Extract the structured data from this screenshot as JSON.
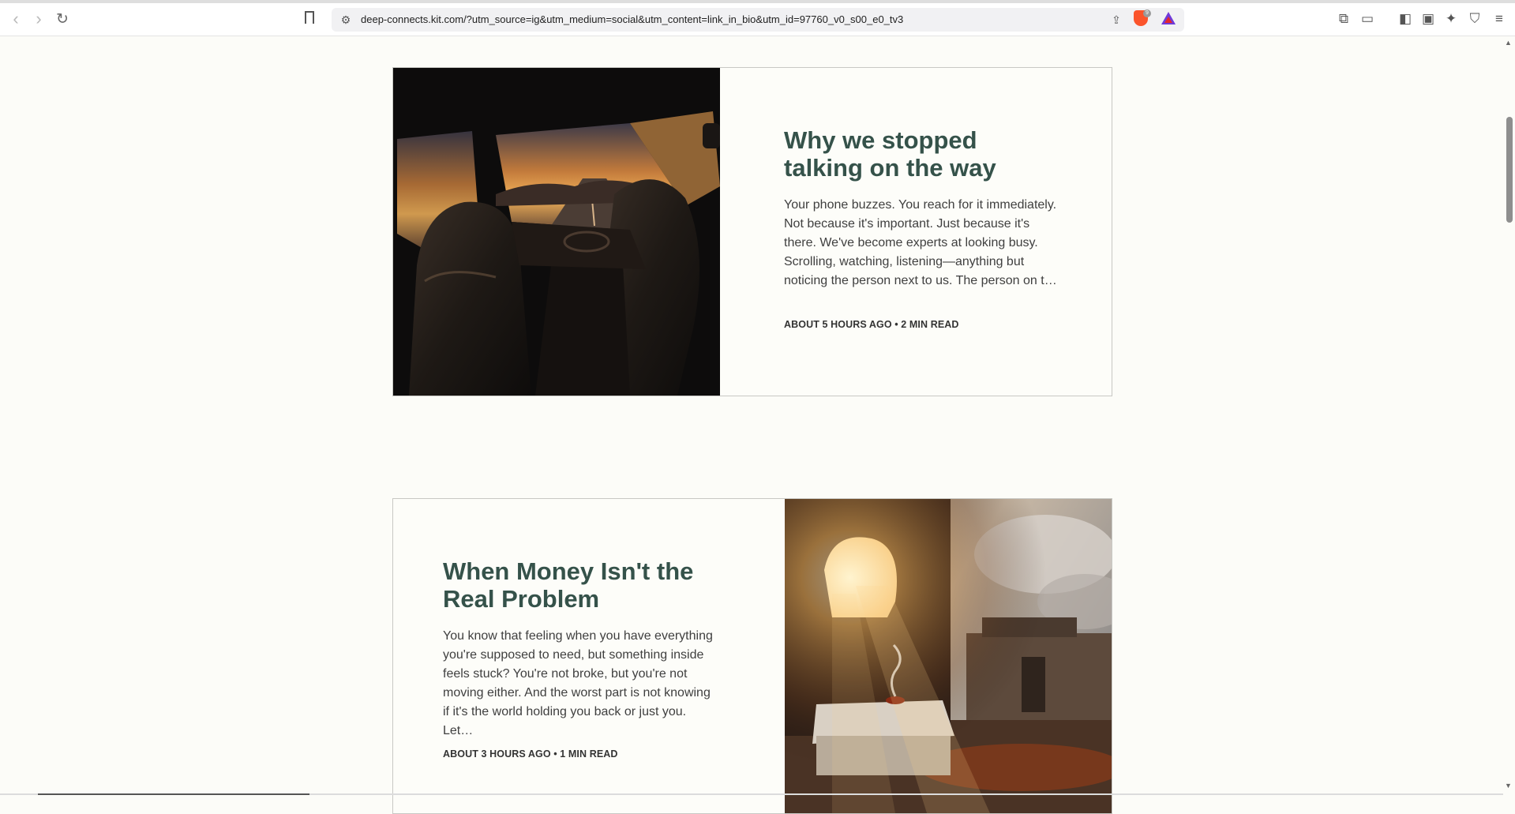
{
  "browser": {
    "url": "deep-connects.kit.com/?utm_source=ig&utm_medium=social&utm_content=link_in_bio&utm_id=97760_v0_s00_e0_tv3",
    "shield_count": "9",
    "icons": {
      "back": "chevron-left-icon",
      "forward": "chevron-right-icon",
      "reload": "reload-icon",
      "bookmark": "bookmark-icon",
      "site_info": "site-settings-icon",
      "share": "share-icon",
      "brave_shield": "brave-shield-icon",
      "rewards": "brave-rewards-icon",
      "extensions": "puzzle-icon",
      "tab_search": "tab-search-icon",
      "sidebar": "sidebar-icon",
      "wallet": "wallet-icon",
      "leo": "sparkle-icon",
      "vpn": "vpn-shield-icon",
      "menu": "hamburger-menu-icon"
    }
  },
  "posts": [
    {
      "title": "Why we stopped talking on the way",
      "excerpt": "Your phone buzzes. You reach for it immediately. Not because it's important. Just because it's there. We've become experts at looking busy. Scrolling, watching, listening—anything but noticing the person next to us. The person on t…",
      "meta": "ABOUT 5 HOURS AGO • 2 MIN READ",
      "image_desc": "car interior at sunset"
    },
    {
      "title": "When Money Isn't the Real Problem",
      "excerpt": "You know that feeling when you have everything you're supposed to need, but something inside feels stuck? You're not broke, but you're not moving either. And the worst part is not knowing if it's the world holding you back or just you. Let…",
      "meta": "ABOUT 3 HOURS AGO • 1 MIN READ",
      "image_desc": "ancient temple ruins with sunlight and incense"
    }
  ],
  "colors": {
    "page_background": "#fcfcf8",
    "title": "#35524a",
    "body_text": "#3f3f3f",
    "card_border": "#c8c8c4"
  }
}
